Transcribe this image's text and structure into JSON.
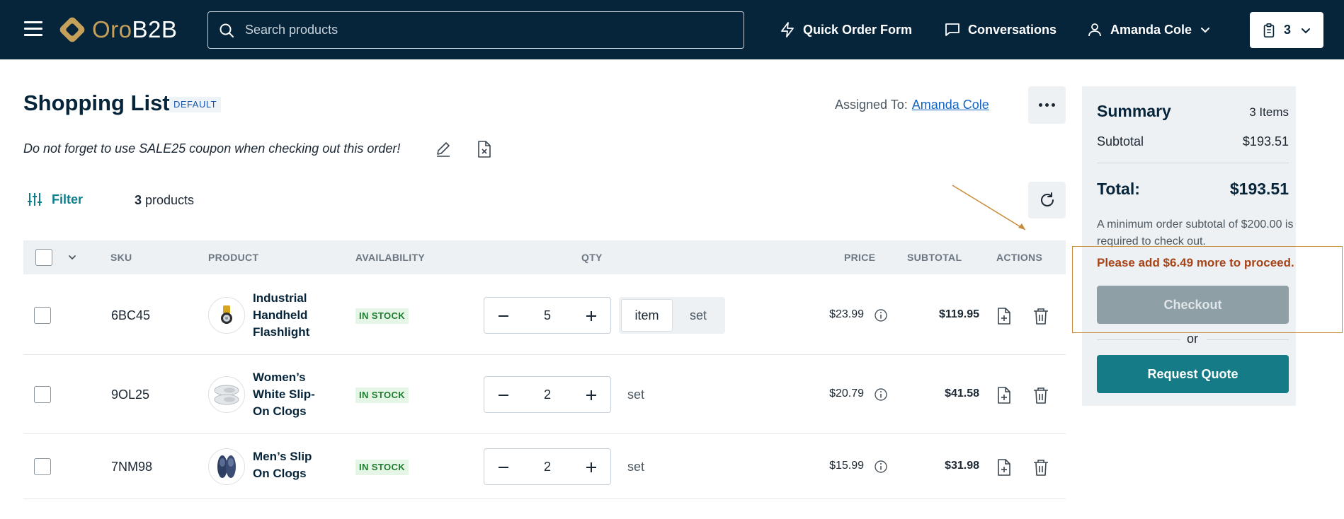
{
  "header": {
    "logo_oro": "Oro",
    "logo_b2b": "B2B",
    "search_placeholder": "Search products",
    "quick_order_label": "Quick Order Form",
    "conversations_label": "Conversations",
    "user_name": "Amanda Cole",
    "cart_count": "3"
  },
  "page": {
    "title": "Shopping List",
    "badge": "DEFAULT",
    "assigned_label": "Assigned To:",
    "assigned_user": "Amanda Cole",
    "note": "Do not forget to use SALE25 coupon when checking out this order!",
    "filter_label": "Filter",
    "product_count": "3",
    "product_count_label": "products"
  },
  "table": {
    "headers": {
      "sku": "SKU",
      "product": "PRODUCT",
      "availability": "AVAILABILITY",
      "qty": "QTY",
      "price": "PRICE",
      "subtotal": "SUBTOTAL",
      "actions": "ACTIONS"
    },
    "rows": [
      {
        "sku": "6BC45",
        "name_lines": [
          "Industrial",
          "Handheld",
          "Flashlight"
        ],
        "availability": "IN STOCK",
        "qty": "5",
        "unit_item": "item",
        "unit_set": "set",
        "price": "$23.99",
        "subtotal": "$119.95"
      },
      {
        "sku": "9OL25",
        "name_lines": [
          "Women’s",
          "White Slip-",
          "On Clogs"
        ],
        "availability": "IN STOCK",
        "qty": "2",
        "unit": "set",
        "price": "$20.79",
        "subtotal": "$41.58"
      },
      {
        "sku": "7NM98",
        "name_lines": [
          "Men’s Slip",
          "On Clogs"
        ],
        "availability": "IN STOCK",
        "qty": "2",
        "unit": "set",
        "price": "$15.99",
        "subtotal": "$31.98"
      }
    ]
  },
  "summary": {
    "title": "Summary",
    "items": "3 Items",
    "subtotal_label": "Subtotal",
    "subtotal_value": "$193.51",
    "total_label": "Total:",
    "total_value": "$193.51",
    "min_order_note": "A minimum order subtotal of $200.00 is required to check out.",
    "warning": "Please add $6.49 more to proceed.",
    "checkout_label": "Checkout",
    "or_label": "or",
    "request_quote_label": "Request Quote"
  },
  "icons": {
    "menu": "hamburger-icon",
    "search": "search-icon",
    "quick_order": "lightning-icon",
    "conversations": "chat-icon",
    "user": "user-icon",
    "cart": "clipboard-icon",
    "filter": "sliders-icon",
    "refresh": "refresh-icon",
    "edit": "pencil-icon",
    "delete_note": "file-x-icon",
    "add_note": "file-plus-icon",
    "delete": "trash-icon",
    "info": "info-icon"
  },
  "colors": {
    "header_bg": "#06253a",
    "accent_teal": "#157b87",
    "logo_gold": "#c5a05a",
    "warning_text": "#a64418",
    "stock_green": "#1d7a2e",
    "annotation": "#c98a3a"
  }
}
